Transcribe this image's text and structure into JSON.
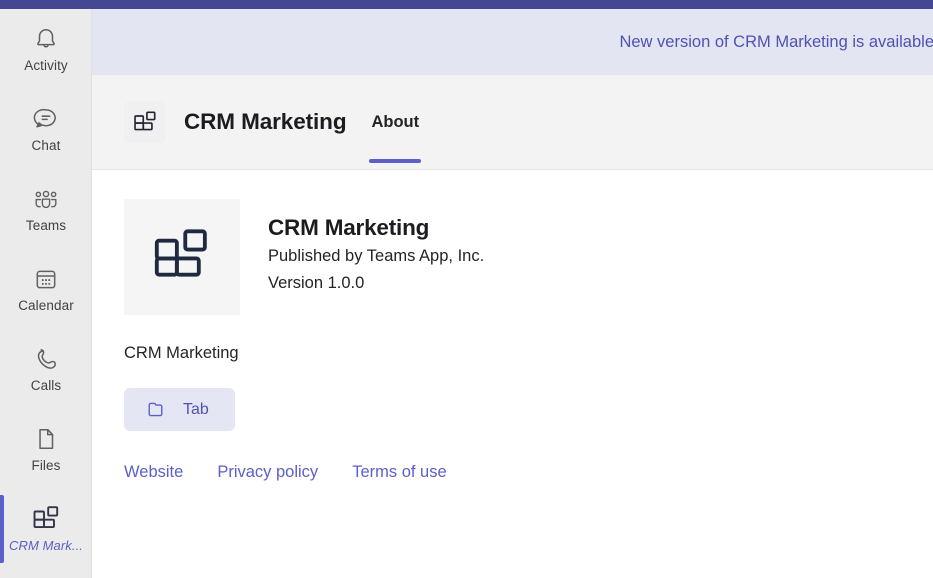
{
  "window": {
    "titlebar_color": "#444791",
    "accent_color": "#5b5fc7"
  },
  "sidebar": {
    "items": [
      {
        "label": "Activity",
        "icon": "bell-icon",
        "selected": false
      },
      {
        "label": "Chat",
        "icon": "chat-icon",
        "selected": false
      },
      {
        "label": "Teams",
        "icon": "teams-icon",
        "selected": false
      },
      {
        "label": "Calendar",
        "icon": "calendar-icon",
        "selected": false
      },
      {
        "label": "Calls",
        "icon": "phone-icon",
        "selected": false
      },
      {
        "label": "Files",
        "icon": "file-icon",
        "selected": false
      },
      {
        "label": "CRM Mark...",
        "icon": "app-blocks-icon",
        "selected": true
      }
    ]
  },
  "banner": {
    "message": "New version of CRM Marketing is available",
    "background": "#e3e5f3",
    "text_color": "#4f52b2"
  },
  "header": {
    "app_icon": "app-blocks-icon",
    "title": "CRM Marketing",
    "tabs": [
      {
        "label": "About",
        "active": true
      }
    ]
  },
  "app_details": {
    "logo_icon": "app-blocks-icon",
    "name": "CRM Marketing",
    "publisher": "Published by Teams App, Inc.",
    "version": "Version 1.0.0",
    "description": "CRM Marketing",
    "capabilities": [
      {
        "label": "Tab",
        "icon": "tab-folder-icon"
      }
    ],
    "links": [
      {
        "label": "Website"
      },
      {
        "label": "Privacy policy"
      },
      {
        "label": "Terms of use"
      }
    ]
  }
}
